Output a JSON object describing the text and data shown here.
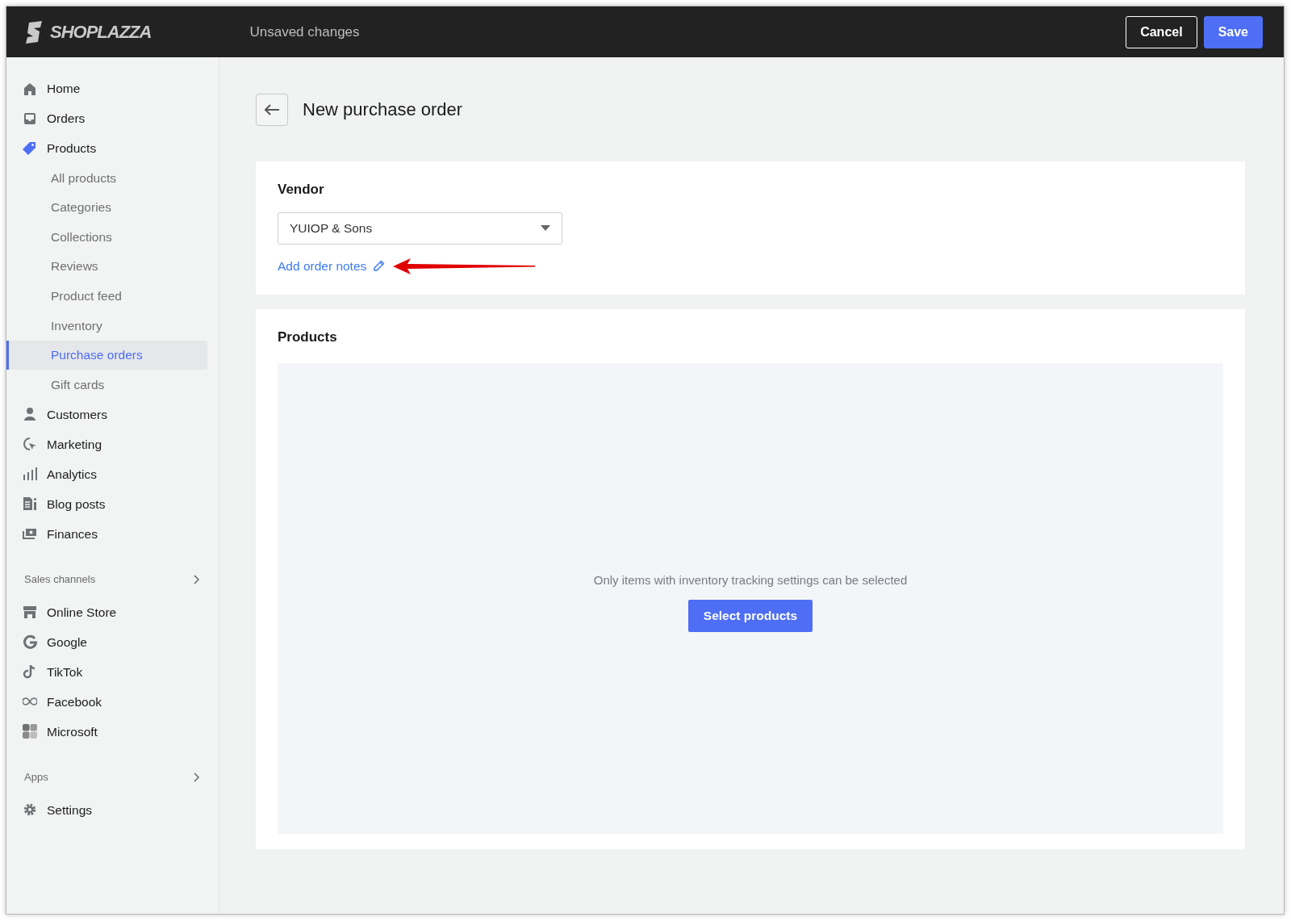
{
  "topbar": {
    "logo": "SHOPLAZZA",
    "status": "Unsaved changes",
    "buttons": [
      {
        "label": "Cancel",
        "kind": "secondary"
      },
      {
        "label": "Save",
        "kind": "primary"
      }
    ]
  },
  "sidebar": {
    "items": [
      {
        "kind": "main",
        "label": "Home",
        "selected": false
      },
      {
        "kind": "main",
        "label": "Orders",
        "selected": false
      },
      {
        "kind": "main",
        "label": "Products",
        "selected": true,
        "children": [
          {
            "label": "All products",
            "selected": false
          },
          {
            "label": "Categories",
            "selected": false
          },
          {
            "label": "Collections",
            "selected": false
          },
          {
            "label": "Reviews",
            "selected": false
          },
          {
            "label": "Product feed",
            "selected": false
          },
          {
            "label": "Inventory",
            "selected": false
          },
          {
            "label": "Purchase orders",
            "selected": true
          },
          {
            "label": "Gift cards",
            "selected": false
          }
        ]
      },
      {
        "kind": "main",
        "label": "Customers",
        "selected": false
      },
      {
        "kind": "main",
        "label": "Marketing",
        "selected": false
      },
      {
        "kind": "main",
        "label": "Analytics",
        "selected": false
      },
      {
        "kind": "main",
        "label": "Blog posts",
        "selected": false
      },
      {
        "kind": "main",
        "label": "Finances",
        "selected": false
      },
      {
        "kind": "section",
        "label": "Sales channels"
      },
      {
        "kind": "main",
        "label": "Online Store",
        "selected": false
      },
      {
        "kind": "main",
        "label": "Google",
        "selected": false
      },
      {
        "kind": "main",
        "label": "TikTok",
        "selected": false
      },
      {
        "kind": "main",
        "label": "Facebook",
        "selected": false
      },
      {
        "kind": "main",
        "label": "Microsoft",
        "selected": false
      },
      {
        "kind": "section",
        "label": "Apps"
      },
      {
        "kind": "main",
        "label": "Settings",
        "selected": false
      }
    ]
  },
  "page": {
    "title": "New purchase order",
    "vendor": {
      "label": "Vendor",
      "value": "YUIOP & Sons",
      "link": "Add order notes"
    },
    "products": {
      "title": "Products",
      "hint": "Only items with inventory tracking settings can be selected",
      "button": "Select products"
    }
  }
}
